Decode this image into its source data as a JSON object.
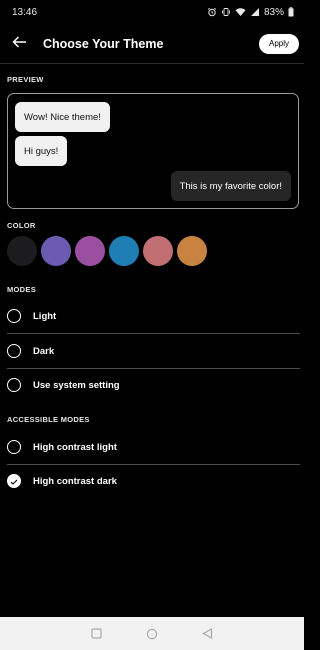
{
  "status_bar": {
    "time": "13:46",
    "battery": "83%"
  },
  "header": {
    "title": "Choose Your Theme",
    "apply_label": "Apply"
  },
  "preview": {
    "label": "PREVIEW",
    "messages": [
      {
        "text": "Wow! Nice theme!",
        "side": "incoming"
      },
      {
        "text": "Hi guys!",
        "side": "incoming"
      },
      {
        "text": "This is my favorite color!",
        "side": "outgoing"
      }
    ]
  },
  "color": {
    "label": "COLOR",
    "swatches": [
      "#1c1c1f",
      "#6a5bb0",
      "#9a4fa0",
      "#1f7fb5",
      "#c26f73",
      "#c98340"
    ]
  },
  "modes": {
    "label": "MODES",
    "options": [
      {
        "label": "Light",
        "selected": false
      },
      {
        "label": "Dark",
        "selected": false
      },
      {
        "label": "Use system setting",
        "selected": false
      }
    ]
  },
  "accessible_modes": {
    "label": "ACCESSIBLE MODES",
    "options": [
      {
        "label": "High contrast light",
        "selected": false
      },
      {
        "label": "High contrast dark",
        "selected": true
      }
    ]
  }
}
